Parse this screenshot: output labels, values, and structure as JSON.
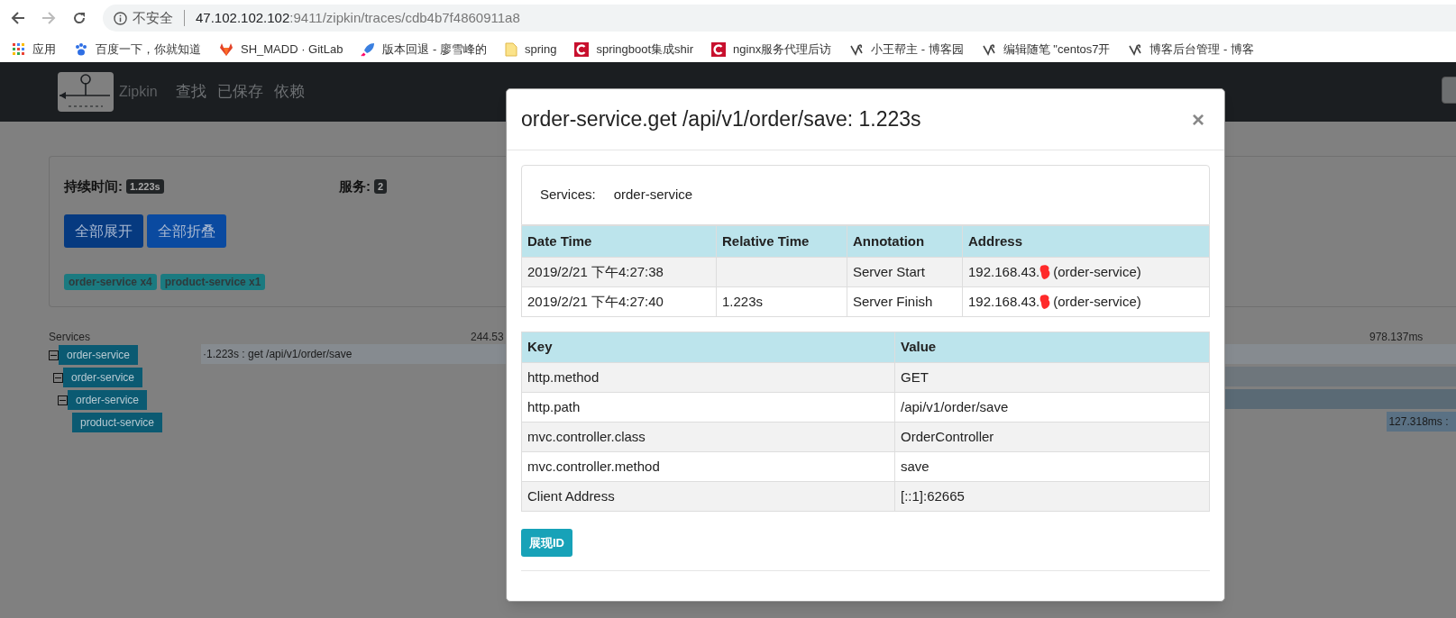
{
  "browser": {
    "security_label": "不安全",
    "url_host": "47.102.102.102",
    "url_path": ":9411/zipkin/traces/cdb4b7f4860911a8",
    "bookmarks": [
      {
        "label": "应用",
        "kind": "apps"
      },
      {
        "label": "百度一下，你就知道",
        "kind": "paw"
      },
      {
        "label": "SH_MADD · GitLab",
        "kind": "fox"
      },
      {
        "label": "版本回退 - 廖雪峰的",
        "kind": "rocket"
      },
      {
        "label": "spring",
        "kind": "folder"
      },
      {
        "label": "springboot集成shir",
        "kind": "red-c"
      },
      {
        "label": "nginx服务代理后访",
        "kind": "red-c"
      },
      {
        "label": "小王帮主 - 博客园",
        "kind": "bird"
      },
      {
        "label": "编辑随笔 \"centos7开",
        "kind": "bird"
      },
      {
        "label": "博客后台管理 - 博客",
        "kind": "bird"
      }
    ]
  },
  "navbar": {
    "brand": "Zipkin",
    "items": [
      "查找",
      "已保存",
      "依赖"
    ]
  },
  "summary": {
    "duration_label": "持续时间:",
    "duration": "1.223s",
    "services_label": "服务:",
    "services_count": "2",
    "buttons": [
      "全部展开",
      "全部折叠"
    ],
    "service_badges": [
      "order-service x4",
      "product-service x1"
    ]
  },
  "timeline": {
    "header": "Services",
    "ticks": [
      "244.53",
      "978.137ms"
    ],
    "spans": [
      {
        "service": "order-service",
        "expanded": true,
        "bar_label": "·1.223s : get /api/v1/order/save",
        "children": [
          {
            "service": "order-service",
            "expanded": true,
            "children": [
              {
                "service": "order-service",
                "expanded": true,
                "children": [
                  {
                    "service": "product-service",
                    "bar_label": "127.318ms :"
                  }
                ]
              }
            ]
          }
        ]
      }
    ]
  },
  "modal": {
    "title": "order-service.get /api/v1/order/save: 1.223s",
    "close": "×",
    "services_label": "Services:",
    "services_value": "order-service",
    "annotations": {
      "columns": [
        "Date Time",
        "Relative Time",
        "Annotation",
        "Address"
      ],
      "rows": [
        {
          "date_time": "2019/2/21 下午4:27:38",
          "annotation": "Server Start",
          "address": "192.168.43.",
          "address_suffix": "(order-service)"
        },
        {
          "date_time": "2019/2/21 下午4:27:40",
          "relative_time": "1.223s",
          "annotation": "Server Finish",
          "address": "192.168.43.",
          "address_suffix": "(order-service)"
        }
      ]
    },
    "tags": {
      "columns": [
        "Key",
        "Value"
      ],
      "rows": [
        {
          "key": "http.method",
          "value": "GET"
        },
        {
          "key": "http.path",
          "value": "/api/v1/order/save"
        },
        {
          "key": "mvc.controller.class",
          "value": "OrderController"
        },
        {
          "key": "mvc.controller.method",
          "value": "save"
        },
        {
          "key": "Client Address",
          "value": "[::1]:62665"
        }
      ]
    },
    "show_id_button": "展现ID"
  }
}
